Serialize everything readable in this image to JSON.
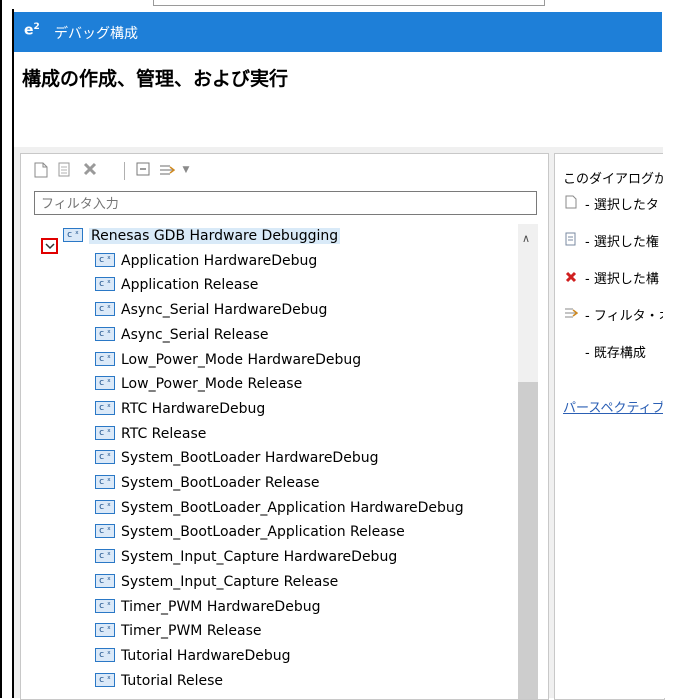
{
  "window": {
    "logo": "e²",
    "title": "デバッグ構成",
    "heading": "構成の作成、管理、および実行"
  },
  "toolbar": {
    "icons": [
      "new-config-icon",
      "duplicate-icon",
      "delete-icon",
      "collapse-all-icon",
      "filter-icon",
      "dropdown-arrow-icon"
    ]
  },
  "filter": {
    "placeholder": "フィルタ入力",
    "value": ""
  },
  "tree": {
    "root": {
      "label": "Renesas GDB Hardware Debugging",
      "expanded": true
    },
    "items": [
      "Application HardwareDebug",
      "Application Release",
      "Async_Serial HardwareDebug",
      "Async_Serial Release",
      "Low_Power_Mode HardwareDebug",
      "Low_Power_Mode Release",
      "RTC HardwareDebug",
      "RTC Release",
      "System_BootLoader HardwareDebug",
      "System_BootLoader Release",
      "System_BootLoader_Application HardwareDebug",
      "System_BootLoader_Application Release",
      "System_Input_Capture HardwareDebug",
      "System_Input_Capture Release",
      "Timer_PWM HardwareDebug",
      "Timer_PWM Release",
      "Tutorial HardwareDebug",
      "Tutorial Relese"
    ],
    "config_icon_text": "c ˣ"
  },
  "help": {
    "intro": "このダイアログから",
    "lines": [
      "- 選択したタ",
      "- 選択した権",
      "- 選択した構",
      "- フィルタ・オ",
      "- 既存構成"
    ],
    "link": "パースペクティブ"
  },
  "colors": {
    "titlebar": "#1e7fd8",
    "selection": "#d9eaf8",
    "highlight_box": "#e00000"
  }
}
